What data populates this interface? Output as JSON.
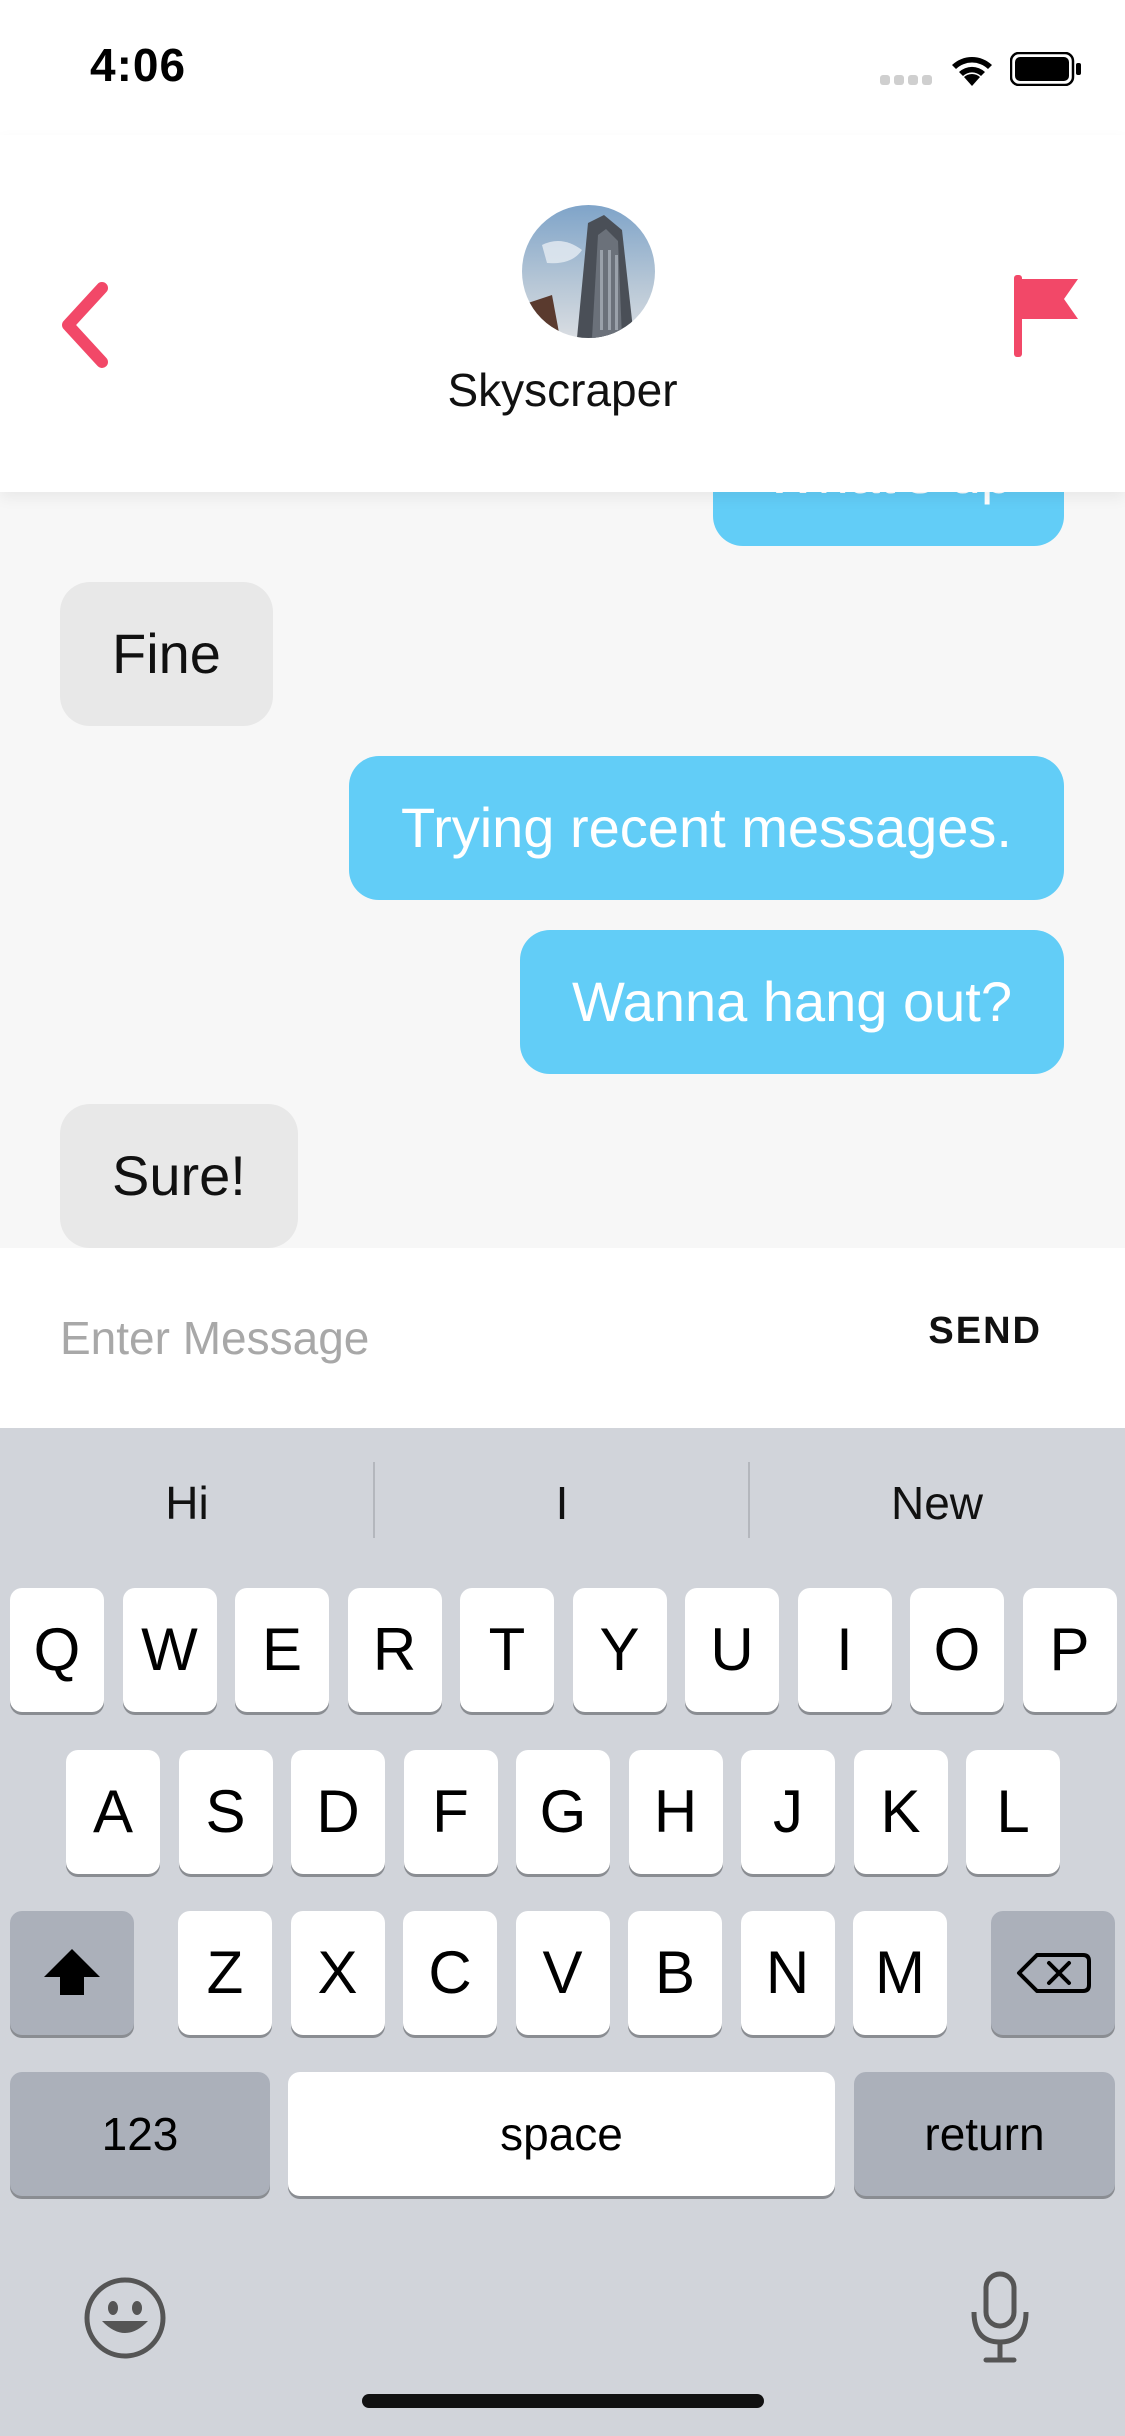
{
  "status": {
    "time": "4:06"
  },
  "header": {
    "contact_name": "Skyscraper"
  },
  "messages": [
    {
      "from": "me",
      "text": "What's up"
    },
    {
      "from": "them",
      "text": "Fine"
    },
    {
      "from": "me",
      "text": "Trying recent messages."
    },
    {
      "from": "me",
      "text": "Wanna hang out?"
    },
    {
      "from": "them",
      "text": "Sure!"
    }
  ],
  "composer": {
    "placeholder": "Enter Message",
    "value": "",
    "send_label": "SEND"
  },
  "keyboard": {
    "suggestions": [
      "Hi",
      "I",
      "New"
    ],
    "row1": [
      "Q",
      "W",
      "E",
      "R",
      "T",
      "Y",
      "U",
      "I",
      "O",
      "P"
    ],
    "row2": [
      "A",
      "S",
      "D",
      "F",
      "G",
      "H",
      "J",
      "K",
      "L"
    ],
    "row3": [
      "Z",
      "X",
      "C",
      "V",
      "B",
      "N",
      "M"
    ],
    "numbers_label": "123",
    "space_label": "space",
    "return_label": "return"
  },
  "colors": {
    "accent": "#f24868",
    "outgoing_bubble": "#62cdf7",
    "incoming_bubble": "#e8e8e8"
  }
}
